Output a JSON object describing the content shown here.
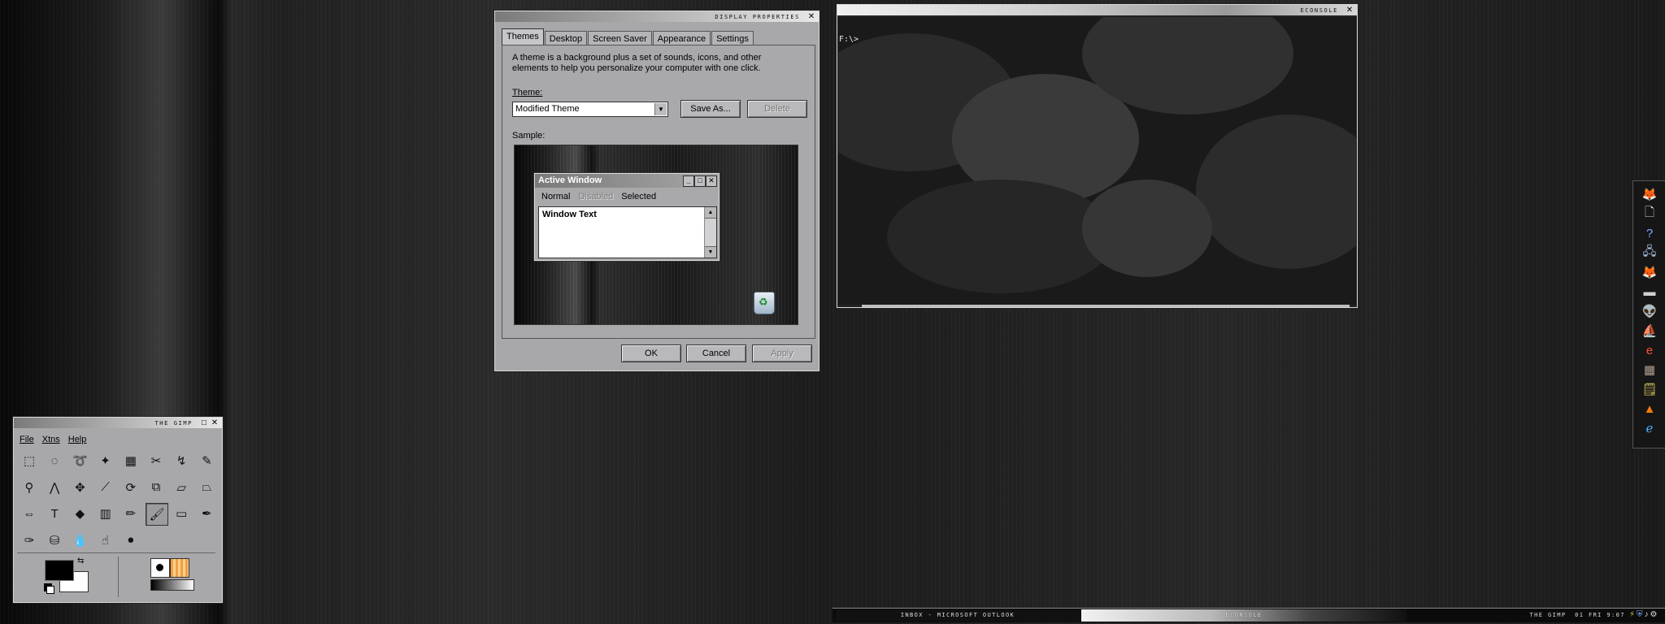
{
  "display_properties": {
    "title": "DISPLAY PROPERTIES",
    "close_icon": "✕",
    "tabs": [
      {
        "label": "Themes"
      },
      {
        "label": "Desktop"
      },
      {
        "label": "Screen Saver"
      },
      {
        "label": "Appearance"
      },
      {
        "label": "Settings"
      }
    ],
    "description": "A theme is a background plus a set of sounds, icons, and other elements to help you personalize your computer with one click.",
    "theme_label": "Theme:",
    "theme_value": "Modified Theme",
    "save_as_label": "Save As...",
    "delete_label": "Delete",
    "sample_label": "Sample:",
    "sample_window": {
      "title": "Active Window",
      "menu": [
        "Normal",
        "Disabled",
        "Selected"
      ],
      "text": "Window Text"
    },
    "ok_label": "OK",
    "cancel_label": "Cancel",
    "apply_label": "Apply"
  },
  "econsole": {
    "title": "ECONSOLE",
    "prompt": "F:\\>"
  },
  "gimp": {
    "title": "THE GIMP",
    "menus": [
      "File",
      "Xtns",
      "Help"
    ],
    "tools": [
      {
        "name": "rect-select-tool-icon",
        "glyph": "⬚"
      },
      {
        "name": "ellipse-select-tool-icon",
        "glyph": "◌"
      },
      {
        "name": "free-select-tool-icon",
        "glyph": "➰"
      },
      {
        "name": "fuzzy-select-tool-icon",
        "glyph": "✦"
      },
      {
        "name": "color-select-tool-icon",
        "glyph": "▦"
      },
      {
        "name": "scissors-tool-icon",
        "glyph": "✂"
      },
      {
        "name": "paths-tool-icon",
        "glyph": "↯"
      },
      {
        "name": "color-picker-tool-icon",
        "glyph": "✎"
      },
      {
        "name": "zoom-tool-icon",
        "glyph": "⚲"
      },
      {
        "name": "measure-tool-icon",
        "glyph": "⋀"
      },
      {
        "name": "move-tool-icon",
        "glyph": "✥"
      },
      {
        "name": "crop-tool-icon",
        "glyph": "⟋"
      },
      {
        "name": "rotate-tool-icon",
        "glyph": "⟳"
      },
      {
        "name": "scale-tool-icon",
        "glyph": "⧉"
      },
      {
        "name": "shear-tool-icon",
        "glyph": "▱"
      },
      {
        "name": "perspective-tool-icon",
        "glyph": "⏢"
      },
      {
        "name": "flip-tool-icon",
        "glyph": "⇔"
      },
      {
        "name": "text-tool-icon",
        "glyph": "T"
      },
      {
        "name": "bucket-fill-tool-icon",
        "glyph": "◆"
      },
      {
        "name": "blend-tool-icon",
        "glyph": "▥"
      },
      {
        "name": "pencil-tool-icon",
        "glyph": "✏"
      },
      {
        "name": "paintbrush-tool-icon",
        "glyph": "🖌"
      },
      {
        "name": "eraser-tool-icon",
        "glyph": "▭"
      },
      {
        "name": "airbrush-tool-icon",
        "glyph": "✒"
      },
      {
        "name": "ink-tool-icon",
        "glyph": "✑"
      },
      {
        "name": "clone-tool-icon",
        "glyph": "⛁"
      },
      {
        "name": "convolve-tool-icon",
        "glyph": "💧"
      },
      {
        "name": "smudge-tool-icon",
        "glyph": "☝"
      },
      {
        "name": "dodge-burn-tool-icon",
        "glyph": "●"
      }
    ]
  },
  "taskbar": {
    "tasks": [
      {
        "label": "INBOX - MICROSOFT OUTLOOK"
      },
      {
        "label": "ECONSOLE"
      }
    ],
    "tray_app": "THE GIMP",
    "clock": "01 FRI 9:07"
  },
  "dock": {
    "icons": [
      {
        "name": "firefox-icon",
        "glyph": "🦊"
      },
      {
        "name": "documents-icon",
        "glyph": "🗋"
      },
      {
        "name": "help-icon",
        "glyph": "?"
      },
      {
        "name": "network-icon",
        "glyph": "🖧"
      },
      {
        "name": "firefox-alt-icon",
        "glyph": "🦊"
      },
      {
        "name": "drive-icon",
        "glyph": "▬"
      },
      {
        "name": "alien-icon",
        "glyph": "👽"
      },
      {
        "name": "ship-icon",
        "glyph": "⛵"
      },
      {
        "name": "e-browser-icon",
        "glyph": "e"
      },
      {
        "name": "calculator-icon",
        "glyph": "▦"
      },
      {
        "name": "notes-icon",
        "glyph": "🗒"
      },
      {
        "name": "vlc-icon",
        "glyph": "▲"
      },
      {
        "name": "internet-explorer-icon",
        "glyph": "ℯ"
      }
    ]
  },
  "colors": {
    "window_face": "#a8a8ab",
    "titlebar_light": "#e8e8e8",
    "desktop_dark": "#1a1a1a"
  }
}
